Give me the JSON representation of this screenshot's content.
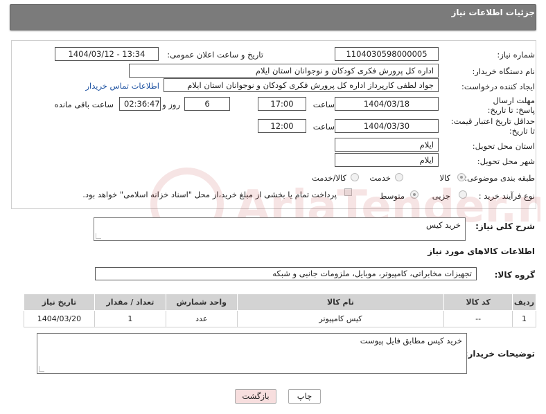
{
  "header": {
    "title": "جزئیات اطلاعات نیاز"
  },
  "fields": {
    "need_number": {
      "label": "شماره نیاز:",
      "value": "1104030598000005"
    },
    "announce_datetime": {
      "label": "تاریخ و ساعت اعلان عمومی:",
      "value": "1404/03/12 - 13:34"
    },
    "buyer_org": {
      "label": "نام دستگاه خریدار:",
      "value": "اداره کل پرورش فکری کودکان و نوجوانان استان ایلام"
    },
    "requester": {
      "label": "ایجاد کننده درخواست:",
      "value": "جواد لطفی کارپرداز اداره کل پرورش فکری کودکان و نوجوانان استان ایلام",
      "link": "اطلاعات تماس خریدار"
    },
    "reply_deadline": {
      "label": "مهلت ارسال پاسخ: تا تاریخ:",
      "date": "1404/03/18",
      "time_label": "ساعت",
      "time": "17:00",
      "days": "6",
      "days_label": "روز و",
      "remaining": "02:36:47",
      "remaining_label": "ساعت باقی مانده"
    },
    "price_validity": {
      "label": "حداقل تاریخ اعتبار قیمت: تا تاریخ:",
      "date": "1404/03/30",
      "time_label": "ساعت",
      "time": "12:00"
    },
    "delivery_province": {
      "label": "استان محل تحویل:",
      "value": "ایلام"
    },
    "delivery_city": {
      "label": "شهر محل تحویل:",
      "value": "ایلام"
    },
    "category": {
      "label": "طبقه بندی موضوعی:",
      "options": [
        "کالا",
        "خدمت",
        "کالا/خدمت"
      ],
      "selected": "کالا"
    },
    "purchase_type": {
      "label": "نوع فرآیند خرید :",
      "options": [
        "جزیی",
        "متوسط"
      ],
      "selected": "متوسط",
      "note": "پرداخت تمام یا بخشی از مبلغ خرید،از محل \"اسناد خزانه اسلامی\" خواهد بود."
    }
  },
  "description": {
    "label": "شرح کلی نیاز:",
    "value": "خرید کیس"
  },
  "goods_section": {
    "title": "اطلاعات کالاهای مورد نیاز"
  },
  "goods_group": {
    "label": "گروه کالا:",
    "value": "تجهیزات مخابراتی، کامپیوتر، موبایل، ملزومات جانبی و شبکه"
  },
  "table": {
    "columns": [
      "ردیف",
      "کد کالا",
      "نام کالا",
      "واحد شمارش",
      "تعداد / مقدار",
      "تاریخ نیاز"
    ],
    "rows": [
      [
        "1",
        "--",
        "کیس کامپیوتر",
        "عدد",
        "1",
        "1404/03/20"
      ]
    ]
  },
  "buyer_notes": {
    "label": "توضیحات خریدار:",
    "value": "خرید کیس مطابق فایل پیوست"
  },
  "buttons": {
    "print": "چاپ",
    "back": "بازگشت"
  },
  "colors": {
    "header_bg": "#7b7b7b",
    "link": "#1a4fa0",
    "back_button_bg": "#f7dede"
  },
  "watermark": "AriaTender.neT"
}
